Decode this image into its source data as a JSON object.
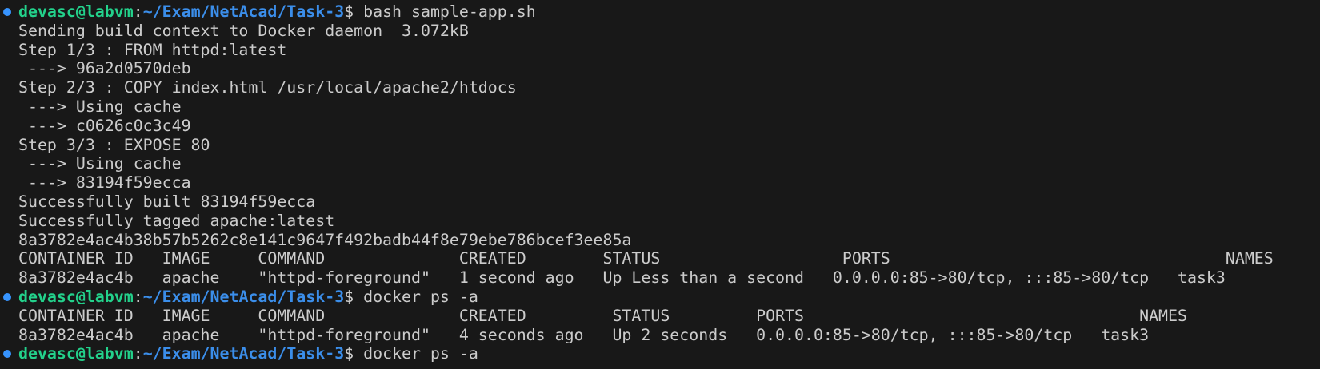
{
  "colors": {
    "background": "#181818",
    "text": "#cccccc",
    "prompt_user": "#23d18b",
    "prompt_path": "#3b8eea",
    "command_decoration": "#3794ff"
  },
  "lines": [
    {
      "kind": "prompt",
      "user": "devasc@labvm",
      "sep": ":",
      "path": "~/Exam/NetAcad/Task-3",
      "dollar": "$",
      "command": " bash sample-app.sh"
    },
    {
      "kind": "output",
      "text": "Sending build context to Docker daemon  3.072kB"
    },
    {
      "kind": "output",
      "text": "Step 1/3 : FROM httpd:latest"
    },
    {
      "kind": "output",
      "text": " ---> 96a2d0570deb"
    },
    {
      "kind": "output",
      "text": "Step 2/3 : COPY index.html /usr/local/apache2/htdocs"
    },
    {
      "kind": "output",
      "text": " ---> Using cache"
    },
    {
      "kind": "output",
      "text": " ---> c0626c0c3c49"
    },
    {
      "kind": "output",
      "text": "Step 3/3 : EXPOSE 80"
    },
    {
      "kind": "output",
      "text": " ---> Using cache"
    },
    {
      "kind": "output",
      "text": " ---> 83194f59ecca"
    },
    {
      "kind": "output",
      "text": "Successfully built 83194f59ecca"
    },
    {
      "kind": "output",
      "text": "Successfully tagged apache:latest"
    },
    {
      "kind": "output",
      "text": "8a3782e4ac4b38b57b5262c8e141c9647f492badb44f8e79ebe786bcef3ee85a"
    },
    {
      "kind": "output",
      "text": "CONTAINER ID   IMAGE     COMMAND              CREATED        STATUS                   PORTS                                   NAMES"
    },
    {
      "kind": "output",
      "text": "8a3782e4ac4b   apache    \"httpd-foreground\"   1 second ago   Up Less than a second   0.0.0.0:85->80/tcp, :::85->80/tcp   task3"
    },
    {
      "kind": "prompt",
      "user": "devasc@labvm",
      "sep": ":",
      "path": "~/Exam/NetAcad/Task-3",
      "dollar": "$",
      "command": " docker ps -a"
    },
    {
      "kind": "output",
      "text": "CONTAINER ID   IMAGE     COMMAND              CREATED         STATUS         PORTS                                   NAMES"
    },
    {
      "kind": "output",
      "text": "8a3782e4ac4b   apache    \"httpd-foreground\"   4 seconds ago   Up 2 seconds   0.0.0.0:85->80/tcp, :::85->80/tcp   task3"
    },
    {
      "kind": "prompt",
      "user": "devasc@labvm",
      "sep": ":",
      "path": "~/Exam/NetAcad/Task-3",
      "dollar": "$",
      "command": " docker ps -a"
    }
  ]
}
